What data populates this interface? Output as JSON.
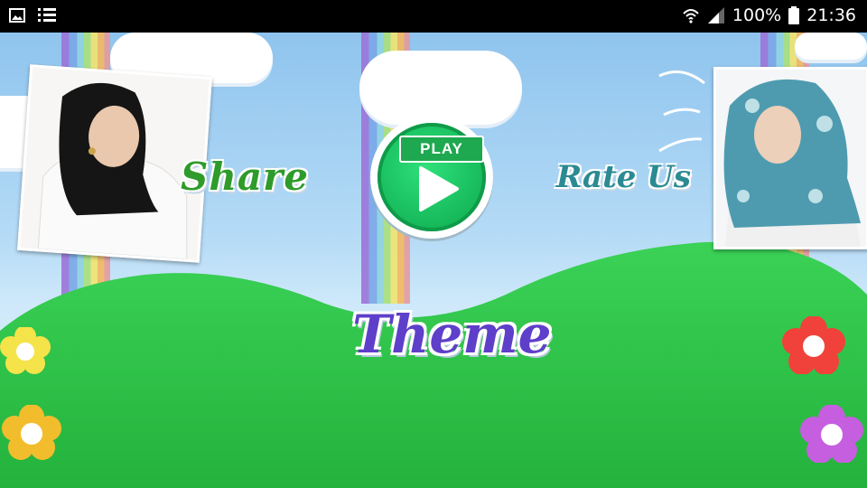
{
  "status_bar": {
    "battery_text": "100%",
    "time": "21:36",
    "left_icons": [
      "image-icon",
      "list-icon"
    ],
    "right_icons": [
      "wifi-icon",
      "signal-icon",
      "battery-icon"
    ]
  },
  "menu": {
    "share_label": "Share",
    "play_label": "PLAY",
    "rate_label": "Rate Us",
    "theme_label": "Theme"
  },
  "colors": {
    "share": "#2e9b2a",
    "rate": "#2b8a92",
    "theme": "#5e3fc9",
    "play": "#16b85a",
    "hill": "#2fc24a"
  }
}
